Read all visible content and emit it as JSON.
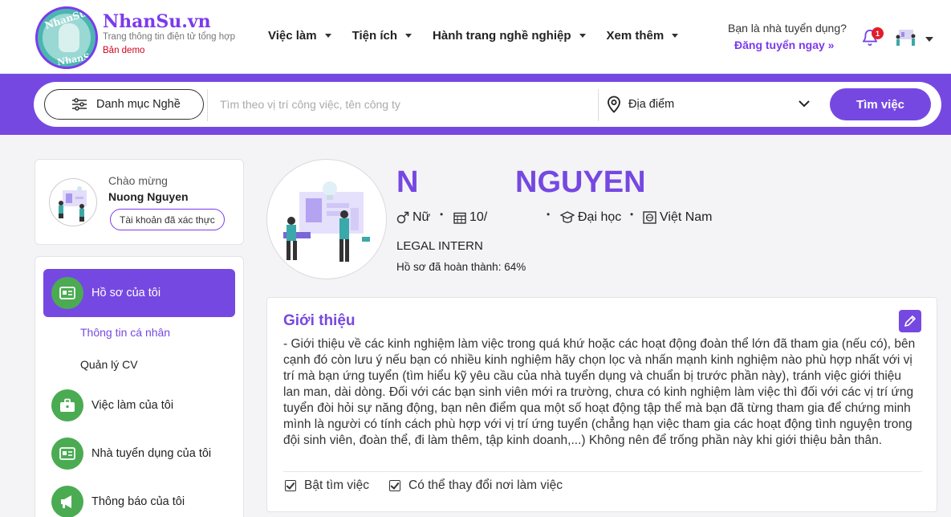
{
  "brand": {
    "logo_text_top": "NhanSu",
    "logo_text_bottom": "NhanSu",
    "name": "NhanSu.vn",
    "tagline": "Trang thông tin điện tử tổng hợp",
    "demo": "Bản demo"
  },
  "nav": {
    "items": [
      {
        "label": "Việc làm"
      },
      {
        "label": "Tiện ích"
      },
      {
        "label": "Hành trang nghề nghiệp"
      },
      {
        "label": "Xem thêm"
      }
    ]
  },
  "recruiter": {
    "question": "Bạn là nhà tuyển dụng?",
    "link": "Đăng tuyển ngay »"
  },
  "notifications": {
    "count": "1"
  },
  "search": {
    "category_label": "Danh mục Nghề",
    "placeholder": "Tìm theo vị trí công việc, tên công ty",
    "location_label": "Địa điểm",
    "button": "Tìm việc"
  },
  "user_card": {
    "greeting": "Chào mừng",
    "name": "Nuong Nguyen",
    "verified": "Tài khoản đã xác thực"
  },
  "menu": {
    "items": [
      {
        "label": "Hồ sơ của tôi",
        "icon": "id-card-icon",
        "active": true
      },
      {
        "label": "Việc làm của tôi",
        "icon": "briefcase-icon"
      },
      {
        "label": "Nhà tuyển dụng của tôi",
        "icon": "id-card-icon"
      },
      {
        "label": "Thông báo của tôi",
        "icon": "megaphone-icon"
      }
    ],
    "sub_items": [
      {
        "label": "Thông tin cá nhân",
        "active": true
      },
      {
        "label": "Quản lý CV"
      }
    ]
  },
  "profile": {
    "first_name": "N",
    "last_name": "NGUYEN",
    "gender": "Nữ",
    "birth": "10/",
    "education": "Đại học",
    "country": "Việt Nam",
    "title": "LEGAL INTERN",
    "completion": "Hồ sơ đã hoàn thành: 64%"
  },
  "about": {
    "heading": "Giới thiệu",
    "text": "- Giới thiệu về các kinh nghiệm làm việc trong quá khứ hoặc các hoạt động đoàn thể lớn đã tham gia (nếu có), bên cạnh đó còn lưu ý nếu bạn có nhiều kinh nghiệm hãy chọn lọc và nhấn mạnh kinh nghiệm nào phù hợp nhất với vị trí mà bạn ứng tuyển (tìm hiểu kỹ yêu cầu của nhà tuyển dụng và chuẩn bị trước phần này), tránh việc giới thiệu lan man, dài dòng. Đối với các bạn sinh viên mới ra trường, chưa có kinh nghiệm làm việc thì đối với các vị trí ứng tuyển đòi hỏi sự năng động, bạn nên điểm qua một số hoạt động tập thể mà bạn đã từng tham gia để chứng minh mình là người có tính cách phù hợp với vị trí ứng tuyển (chẳng hạn việc tham gia các hoạt động tình nguyện trong đội sinh viên, đoàn thể, đi làm thêm, tập kinh doanh,...) Không nên để trống phần này khi giới thiệu bản thân.",
    "check_job_search": "Bật tìm việc",
    "check_relocate": "Có thể thay đổi nơi làm việc"
  },
  "colors": {
    "accent": "#7648e2",
    "menu_icon_bg": "#4bab52",
    "notif_badge": "#e11d2a"
  }
}
